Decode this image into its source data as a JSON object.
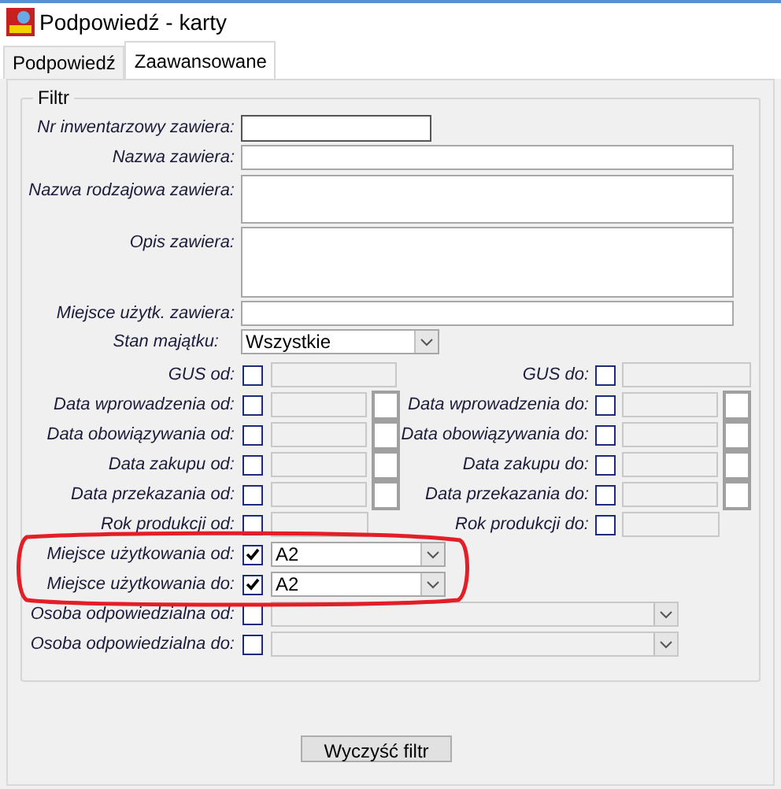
{
  "window": {
    "title": "Podpowiedź - karty"
  },
  "tabs": [
    {
      "label": "Podpowiedź",
      "selected": false
    },
    {
      "label": "Zaawansowane",
      "selected": true
    }
  ],
  "filter": {
    "title": "Filtr",
    "text_fields": [
      {
        "label": "Nr inwentarzowy zawiera:",
        "kind": "short"
      },
      {
        "label": "Nazwa zawiera:",
        "kind": "line"
      },
      {
        "label": "Nazwa rodzajowa zawiera:",
        "kind": "area"
      },
      {
        "label": "Opis zawiera:",
        "kind": "tall"
      },
      {
        "label": "Miejsce użytk. zawiera:",
        "kind": "line"
      }
    ],
    "status_select": {
      "label": "Stan majątku:",
      "value": "Wszystkie"
    },
    "range_rows": [
      {
        "from": {
          "label": "GUS od:",
          "checked": false,
          "kind": "code"
        },
        "to": {
          "label": "GUS do:",
          "checked": false,
          "kind": "code"
        }
      },
      {
        "from": {
          "label": "Data wprowadzenia od:",
          "checked": false,
          "kind": "date"
        },
        "to": {
          "label": "Data wprowadzenia do:",
          "checked": false,
          "kind": "date"
        }
      },
      {
        "from": {
          "label": "Data obowiązywania od:",
          "checked": false,
          "kind": "date"
        },
        "to": {
          "label": "Data obowiązywania do:",
          "checked": false,
          "kind": "date"
        }
      },
      {
        "from": {
          "label": "Data zakupu od:",
          "checked": false,
          "kind": "date"
        },
        "to": {
          "label": "Data zakupu do:",
          "checked": false,
          "kind": "date"
        }
      },
      {
        "from": {
          "label": "Data przekazania od:",
          "checked": false,
          "kind": "date"
        },
        "to": {
          "label": "Data przekazania do:",
          "checked": false,
          "kind": "date"
        }
      },
      {
        "from": {
          "label": "Rok produkcji od:",
          "checked": false,
          "kind": "year"
        },
        "to": {
          "label": "Rok produkcji do:",
          "checked": false,
          "kind": "year"
        }
      }
    ],
    "combo_rows": [
      {
        "label": "Miejsce użytkowania od:",
        "checked": true,
        "value": "A2",
        "disabled": false
      },
      {
        "label": "Miejsce użytkowania do:",
        "checked": true,
        "value": "A2",
        "disabled": false
      },
      {
        "label": "Osoba odpowiedzialna od:",
        "checked": false,
        "disabled": true
      },
      {
        "label": "Osoba odpowiedzialna do:",
        "checked": false,
        "disabled": true
      }
    ]
  },
  "buttons": [
    {
      "label": "Wyczyść filtr"
    }
  ]
}
